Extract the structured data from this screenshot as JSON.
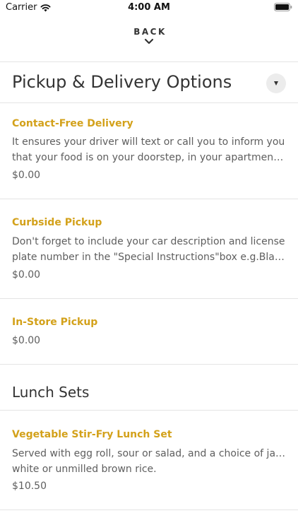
{
  "status_bar": {
    "carrier": "Carrier",
    "time": "4:00 AM",
    "icons": [
      "wifi-icon",
      "battery-icon"
    ]
  },
  "nav": {
    "back_label": "BACK",
    "icon": "chevron-down-icon"
  },
  "sections": [
    {
      "title": "Pickup & Delivery Options",
      "toggle_icon": "caret-down-icon",
      "items": [
        {
          "name": "Contact-Free Delivery",
          "description_lines": [
            "It ensures your driver will text or call you to inform you",
            "that your food is on your doorstep, in your apartment bu..."
          ],
          "price": "$0.00"
        },
        {
          "name": "Curbside Pickup",
          "description_lines": [
            "Don't forget to include your car description and license",
            "plate number in the \"Special Instructions\"box e.g.Black F..."
          ],
          "price": "$0.00"
        },
        {
          "name": "In-Store Pickup",
          "price": "$0.00"
        }
      ]
    },
    {
      "title": "Lunch Sets",
      "items": [
        {
          "name": "Vegetable Stir-Fry Lunch Set",
          "description_lines": [
            "Served with egg roll, sour or salad, and a choice of jasmine",
            "white or unmilled brown rice."
          ],
          "price": "$10.50"
        }
      ]
    }
  ],
  "colors": {
    "accent": "#d3a11a",
    "text": "#333333",
    "muted": "#5e5e5e",
    "divider": "#e4e4e4"
  }
}
